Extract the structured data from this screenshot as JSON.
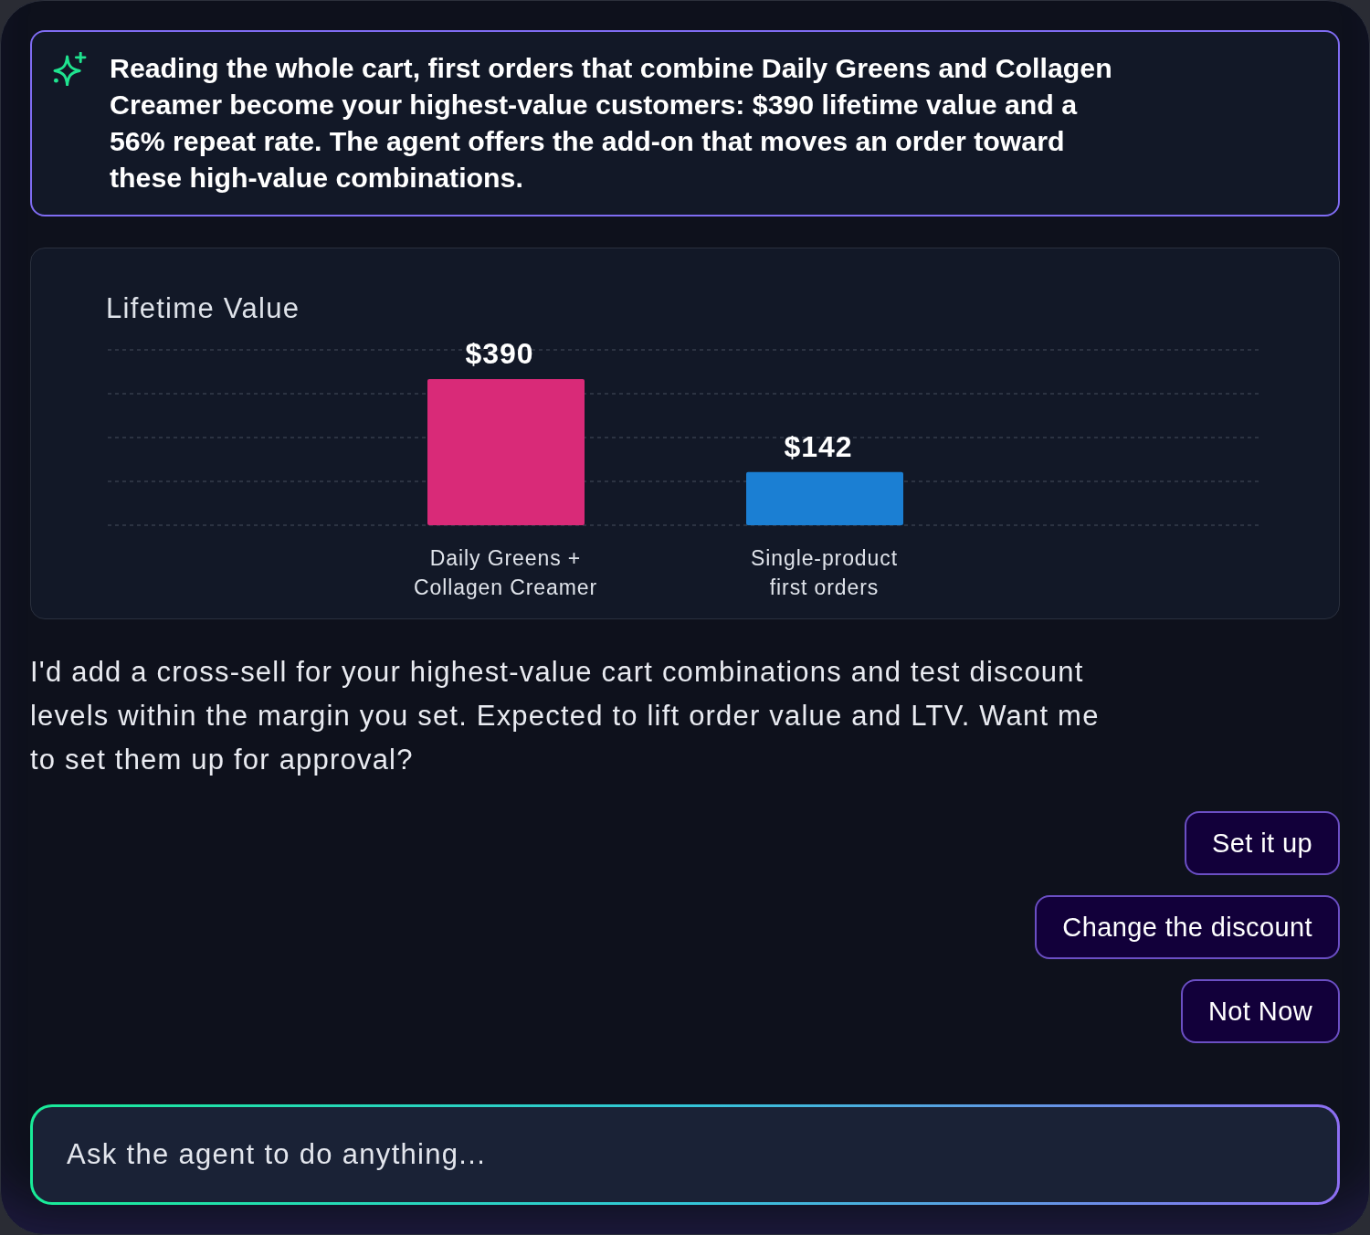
{
  "insight": {
    "text": "Reading the whole cart, first orders that combine Daily Greens and Collagen Creamer become your highest-value customers: $390 lifetime value and a 56% repeat rate. The agent offers the add-on that moves an order toward these high-value combinations."
  },
  "chart": {
    "chart_data": {
      "type": "bar",
      "title": "Lifetime Value",
      "categories": [
        "Daily Greens + Collagen Creamer",
        "Single-product first orders"
      ],
      "values": [
        390,
        142
      ],
      "colors": [
        "#d92a78",
        "#1b7fd3"
      ],
      "value_labels": [
        "$390",
        "$142"
      ]
    }
  },
  "message": {
    "text": "I'd add a cross-sell for your highest-value cart combinations and test discount levels within the margin you set. Expected to lift order value and LTV. Want me to set them up for approval?"
  },
  "actions": [
    "Set it up",
    "Change the discount",
    "Not Now"
  ],
  "input": {
    "placeholder": "Ask the agent to do anything..."
  }
}
